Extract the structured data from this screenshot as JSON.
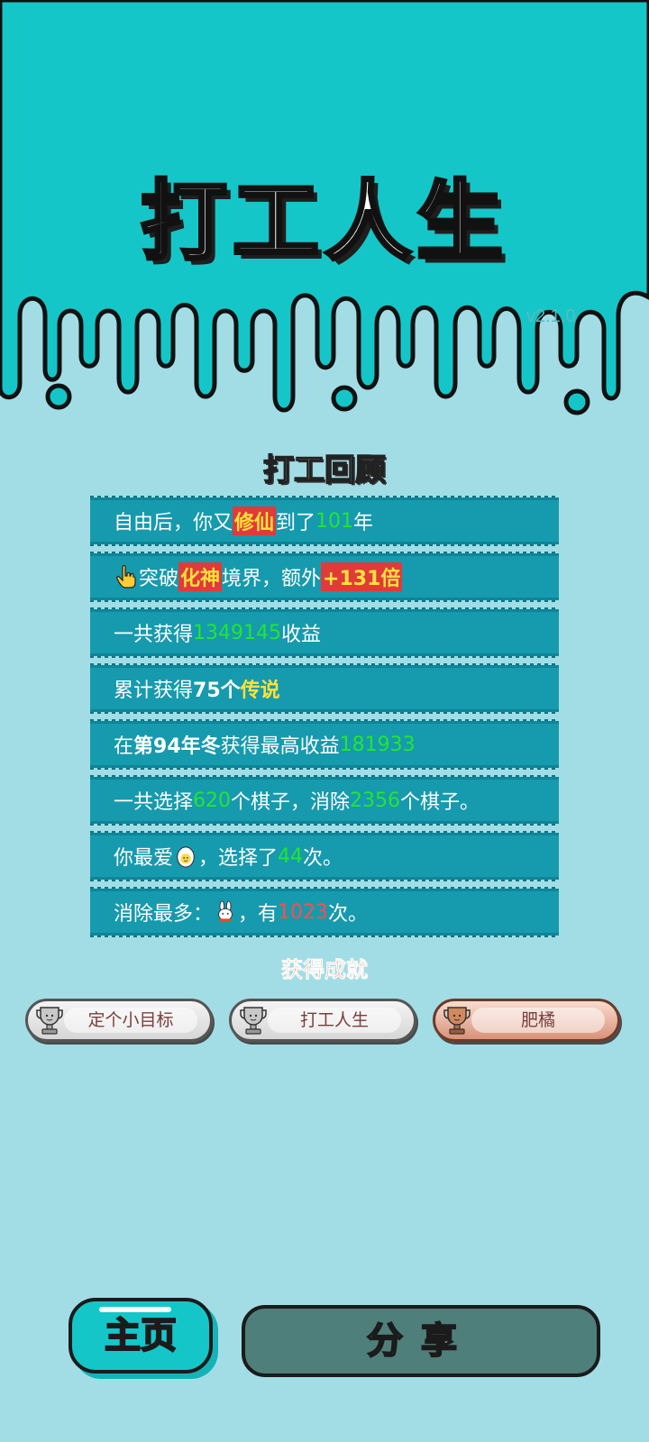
{
  "app": {
    "title": "打工人生",
    "version": "v2.1.0"
  },
  "review": {
    "heading": "打工回顾",
    "rows": [
      {
        "p1": "自由后，你又",
        "realm": "修仙",
        "p2": "到了",
        "years": "101",
        "p3": "年"
      },
      {
        "p1": "突破",
        "realm": "化神",
        "p2": "境界，额外",
        "mult": "+131倍"
      },
      {
        "p1": "一共获得",
        "income": "1349145",
        "p2": "收益"
      },
      {
        "p1": "累计获得",
        "count": "75个",
        "legend": "传说"
      },
      {
        "p1": "在 ",
        "season": "第94年冬",
        "p2": " 获得最高收益",
        "max": "181933"
      },
      {
        "p1": "一共选择",
        "chosen": "620",
        "p2": "个棋子，消除",
        "cleared": "2356",
        "p3": "个棋子。"
      },
      {
        "p1": "你最爱",
        "p2": "，选择了",
        "times": "44",
        "p3": "次。"
      },
      {
        "p1": "消除最多：",
        "p2": "，有",
        "most": "1023",
        "p3": "次。"
      }
    ]
  },
  "achievements": {
    "heading": "获得成就",
    "items": [
      {
        "label": "定个小目标",
        "tier": "silver"
      },
      {
        "label": "打工人生",
        "tier": "silver"
      },
      {
        "label": "肥橘",
        "tier": "bronze"
      }
    ]
  },
  "buttons": {
    "home": "主页",
    "share": "分享"
  },
  "icons": {
    "row2": "pointing-hand-icon",
    "row7": "egg-icon",
    "row8": "rabbit-icon",
    "trophy": "trophy-icon"
  },
  "colors": {
    "background": "#a2dde6",
    "top_band": "#15c6c8",
    "row": "#169aae",
    "green_value": "#22e632",
    "red_value": "#ff4d4d",
    "share_button": "#4f7f7b"
  }
}
